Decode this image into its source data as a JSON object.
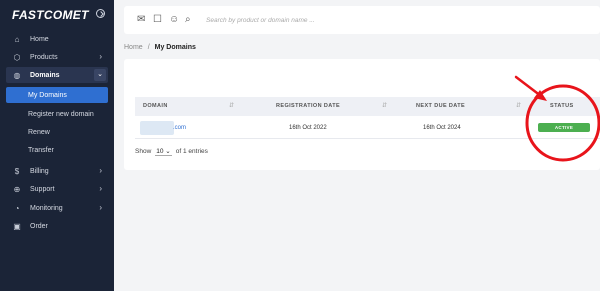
{
  "brand": {
    "logo": "FASTCOMET"
  },
  "sidebar": {
    "items": [
      {
        "label": "Home",
        "icon": "home-icon"
      },
      {
        "label": "Products",
        "icon": "box-icon"
      },
      {
        "label": "Domains",
        "icon": "globe-icon"
      },
      {
        "label": "Billing",
        "icon": "dollar-icon"
      },
      {
        "label": "Support",
        "icon": "lifebuoy-icon"
      },
      {
        "label": "Monitoring",
        "icon": "gauge-icon"
      },
      {
        "label": "Order",
        "icon": "calendar-icon"
      }
    ],
    "domains_sub": [
      {
        "label": "My Domains"
      },
      {
        "label": "Register new domain"
      },
      {
        "label": "Renew"
      },
      {
        "label": "Transfer"
      }
    ]
  },
  "topbar": {
    "icons": [
      "mail-icon",
      "chat-icon",
      "support-icon",
      "search-icon"
    ],
    "search_placeholder": "Search by product or domain name ..."
  },
  "breadcrumb": {
    "home": "Home",
    "separator": "/",
    "current": "My Domains"
  },
  "table": {
    "headers": [
      "DOMAIN",
      "REGISTRATION DATE",
      "NEXT DUE DATE",
      "STATUS"
    ],
    "rows": [
      {
        "domain_suffix": ".com",
        "registration_date": "16th Oct 2022",
        "next_due_date": "16th Oct 2024",
        "status": "ACTIVE"
      }
    ],
    "footer": {
      "show_label": "Show",
      "page_size": "10",
      "entries_text": "of 1 entries"
    }
  },
  "colors": {
    "sidebar_bg": "#1b2437",
    "active_blue": "#2f6fd1",
    "status_green": "#4caf50",
    "annotation_red": "#e8141b"
  }
}
